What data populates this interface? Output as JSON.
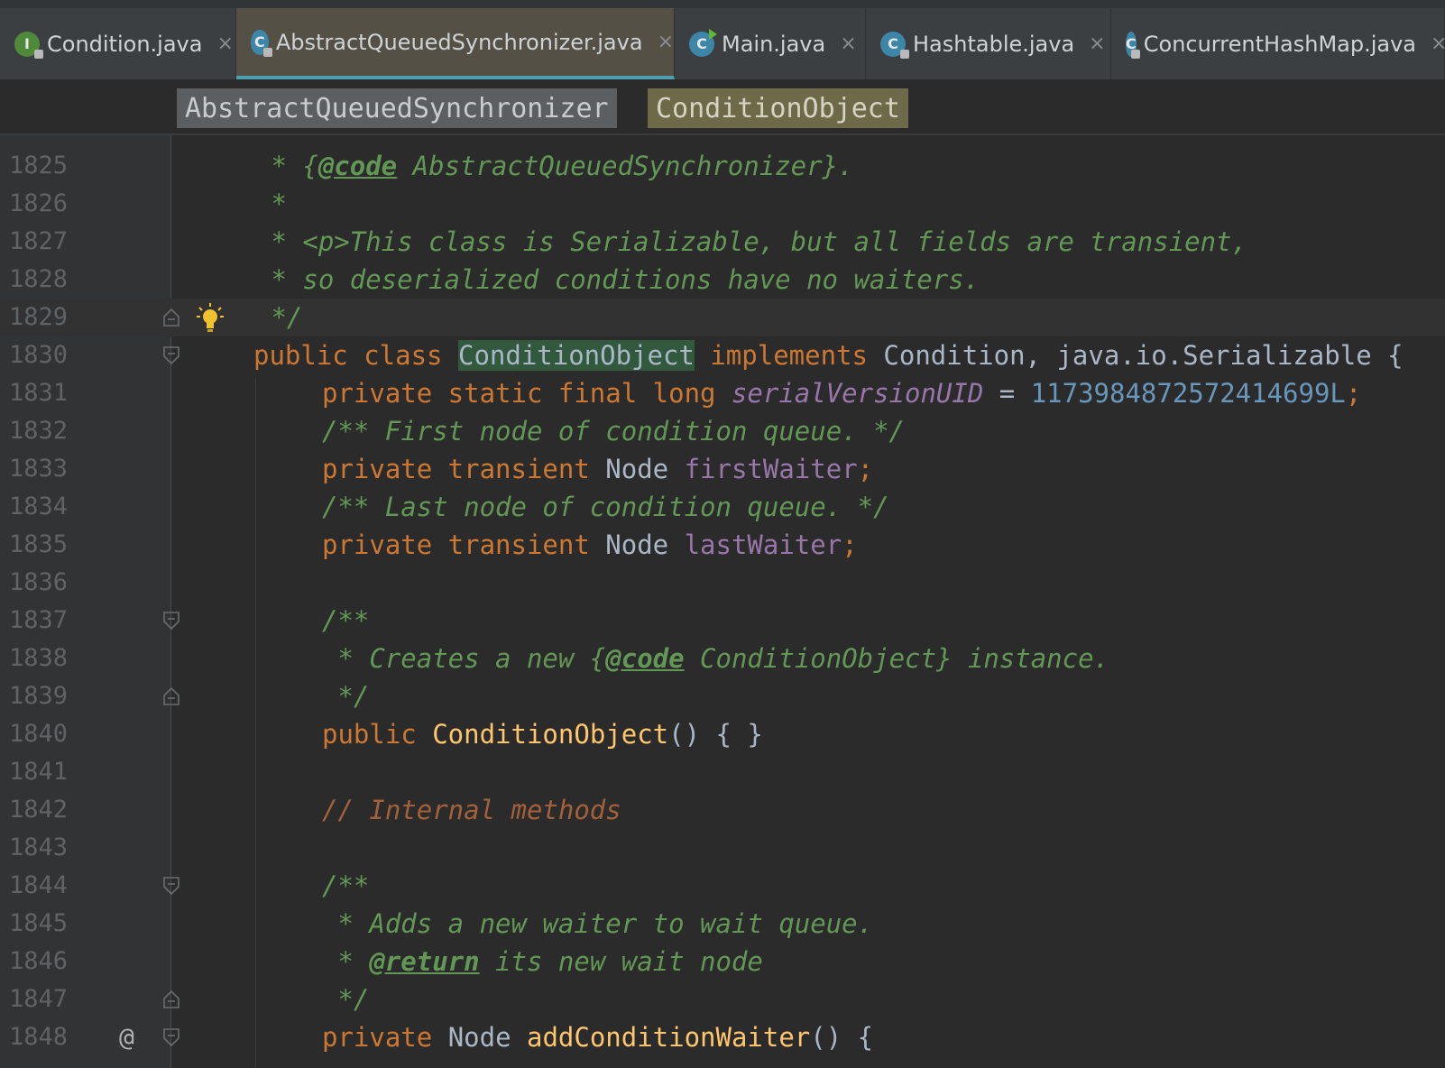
{
  "tabs": [
    {
      "label": "Condition.java",
      "icon": "interface-icon",
      "icon_letter": "I",
      "close": "×"
    },
    {
      "label": "AbstractQueuedSynchronizer.java",
      "icon": "class-icon",
      "icon_letter": "C",
      "close": "×"
    },
    {
      "label": "Main.java",
      "icon": "runnable-class-icon",
      "icon_letter": "C",
      "close": "×"
    },
    {
      "label": "Hashtable.java",
      "icon": "class-icon",
      "icon_letter": "C",
      "close": "×"
    },
    {
      "label": "ConcurrentHashMap.java",
      "icon": "class-icon",
      "icon_letter": "C",
      "close": "×"
    }
  ],
  "active_tab": "AbstractQueuedSynchronizer.java",
  "breadcrumb": [
    "AbstractQueuedSynchronizer",
    "ConditionObject"
  ],
  "line_numbers": [
    "1825",
    "1826",
    "1827",
    "1828",
    "1829",
    "1830",
    "1831",
    "1832",
    "1833",
    "1834",
    "1835",
    "1836",
    "1837",
    "1838",
    "1839",
    "1840",
    "1841",
    "1842",
    "1843",
    "1844",
    "1845",
    "1846",
    "1847",
    "1848"
  ],
  "code": {
    "l1825": {
      "star": " * {",
      "tag": "@code",
      "rest": " AbstractQueuedSynchronizer}."
    },
    "l1826": {
      "text": " *"
    },
    "l1827": {
      "text": " * <p>This class is Serializable, but all fields are transient,"
    },
    "l1828": {
      "text": " * so deserialized conditions have no waiters."
    },
    "l1829": {
      "text": " */"
    },
    "l1830": {
      "kw1": "public class ",
      "name": "ConditionObject",
      "kw2": " implements ",
      "rest": "Condition, java.io.Serializable {"
    },
    "l1831": {
      "kw": "private static final long ",
      "field": "serialVersionUID",
      "eq": " = ",
      "num": "1173984872572414699L",
      "semi": ";"
    },
    "l1832": {
      "text": "/** First node of condition queue. */"
    },
    "l1833": {
      "kw": "private transient ",
      "type": "Node ",
      "field": "firstWaiter",
      "semi": ";"
    },
    "l1834": {
      "text": "/** Last node of condition queue. */"
    },
    "l1835": {
      "kw": "private transient ",
      "type": "Node ",
      "field": "lastWaiter",
      "semi": ";"
    },
    "l1837": {
      "text": "/**"
    },
    "l1838": {
      "star": " * Creates a new {",
      "tag": "@code",
      "rest": " ConditionObject} instance."
    },
    "l1839": {
      "text": " */"
    },
    "l1840": {
      "kw": "public ",
      "fn": "ConditionObject",
      "rest": "() { }"
    },
    "l1842": {
      "text": "// Internal methods"
    },
    "l1844": {
      "text": "/**"
    },
    "l1845": {
      "text": " * Adds a new waiter to wait queue."
    },
    "l1846": {
      "star": " * ",
      "tag": "@return",
      "rest": " its new wait node"
    },
    "l1847": {
      "text": " */"
    },
    "l1848": {
      "kw": "private ",
      "type": "Node ",
      "fn": "addConditionWaiter",
      "rest": "() {"
    }
  },
  "gutter": {
    "at_marker": "@"
  },
  "colors": {
    "keyword": "#cc7832",
    "doc_comment": "#629755",
    "field": "#9876aa",
    "number": "#6897bb",
    "method": "#ffc66d",
    "highlight": "#32593d"
  }
}
